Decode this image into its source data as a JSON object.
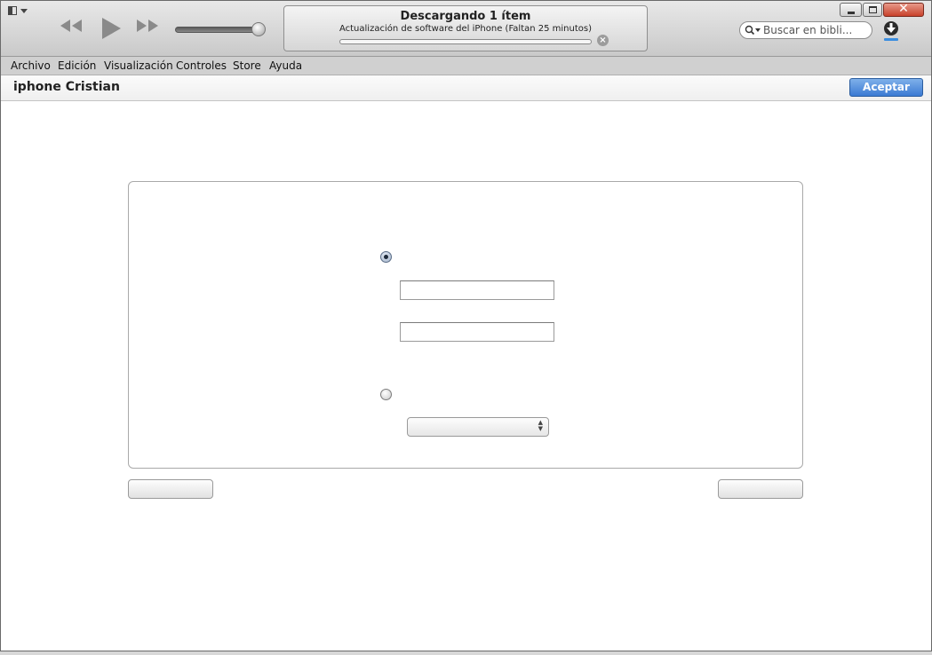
{
  "colors": {
    "accent": "#3b7ad3",
    "toolbar_top": "#e8e8e8",
    "toolbar_bottom": "#c9c9c9"
  },
  "transport": {
    "previous_icon": "rewind-icon",
    "play_icon": "play-icon",
    "next_icon": "fast-forward-icon"
  },
  "lcd": {
    "title": "Descargando 1 ítem",
    "subtitle": "Actualización de software del iPhone (Faltan 25 minutos)",
    "progress": 0.0,
    "cancel_glyph": "×"
  },
  "search": {
    "placeholder": "Buscar en bibli...",
    "value": ""
  },
  "window_controls": {
    "close_glyph": "✕"
  },
  "menu": [
    "Archivo",
    "Edición",
    "Visualización",
    "Controles",
    "Store",
    "Ayuda"
  ],
  "header": {
    "device_name": "iphone Cristian",
    "accept_label": "Aceptar"
  },
  "form": {
    "option_1_selected": true,
    "option_2_selected": false,
    "field_1_value": "",
    "field_2_value": "",
    "select_value": ""
  },
  "footer": {
    "left_button_label": "",
    "right_button_label": ""
  }
}
